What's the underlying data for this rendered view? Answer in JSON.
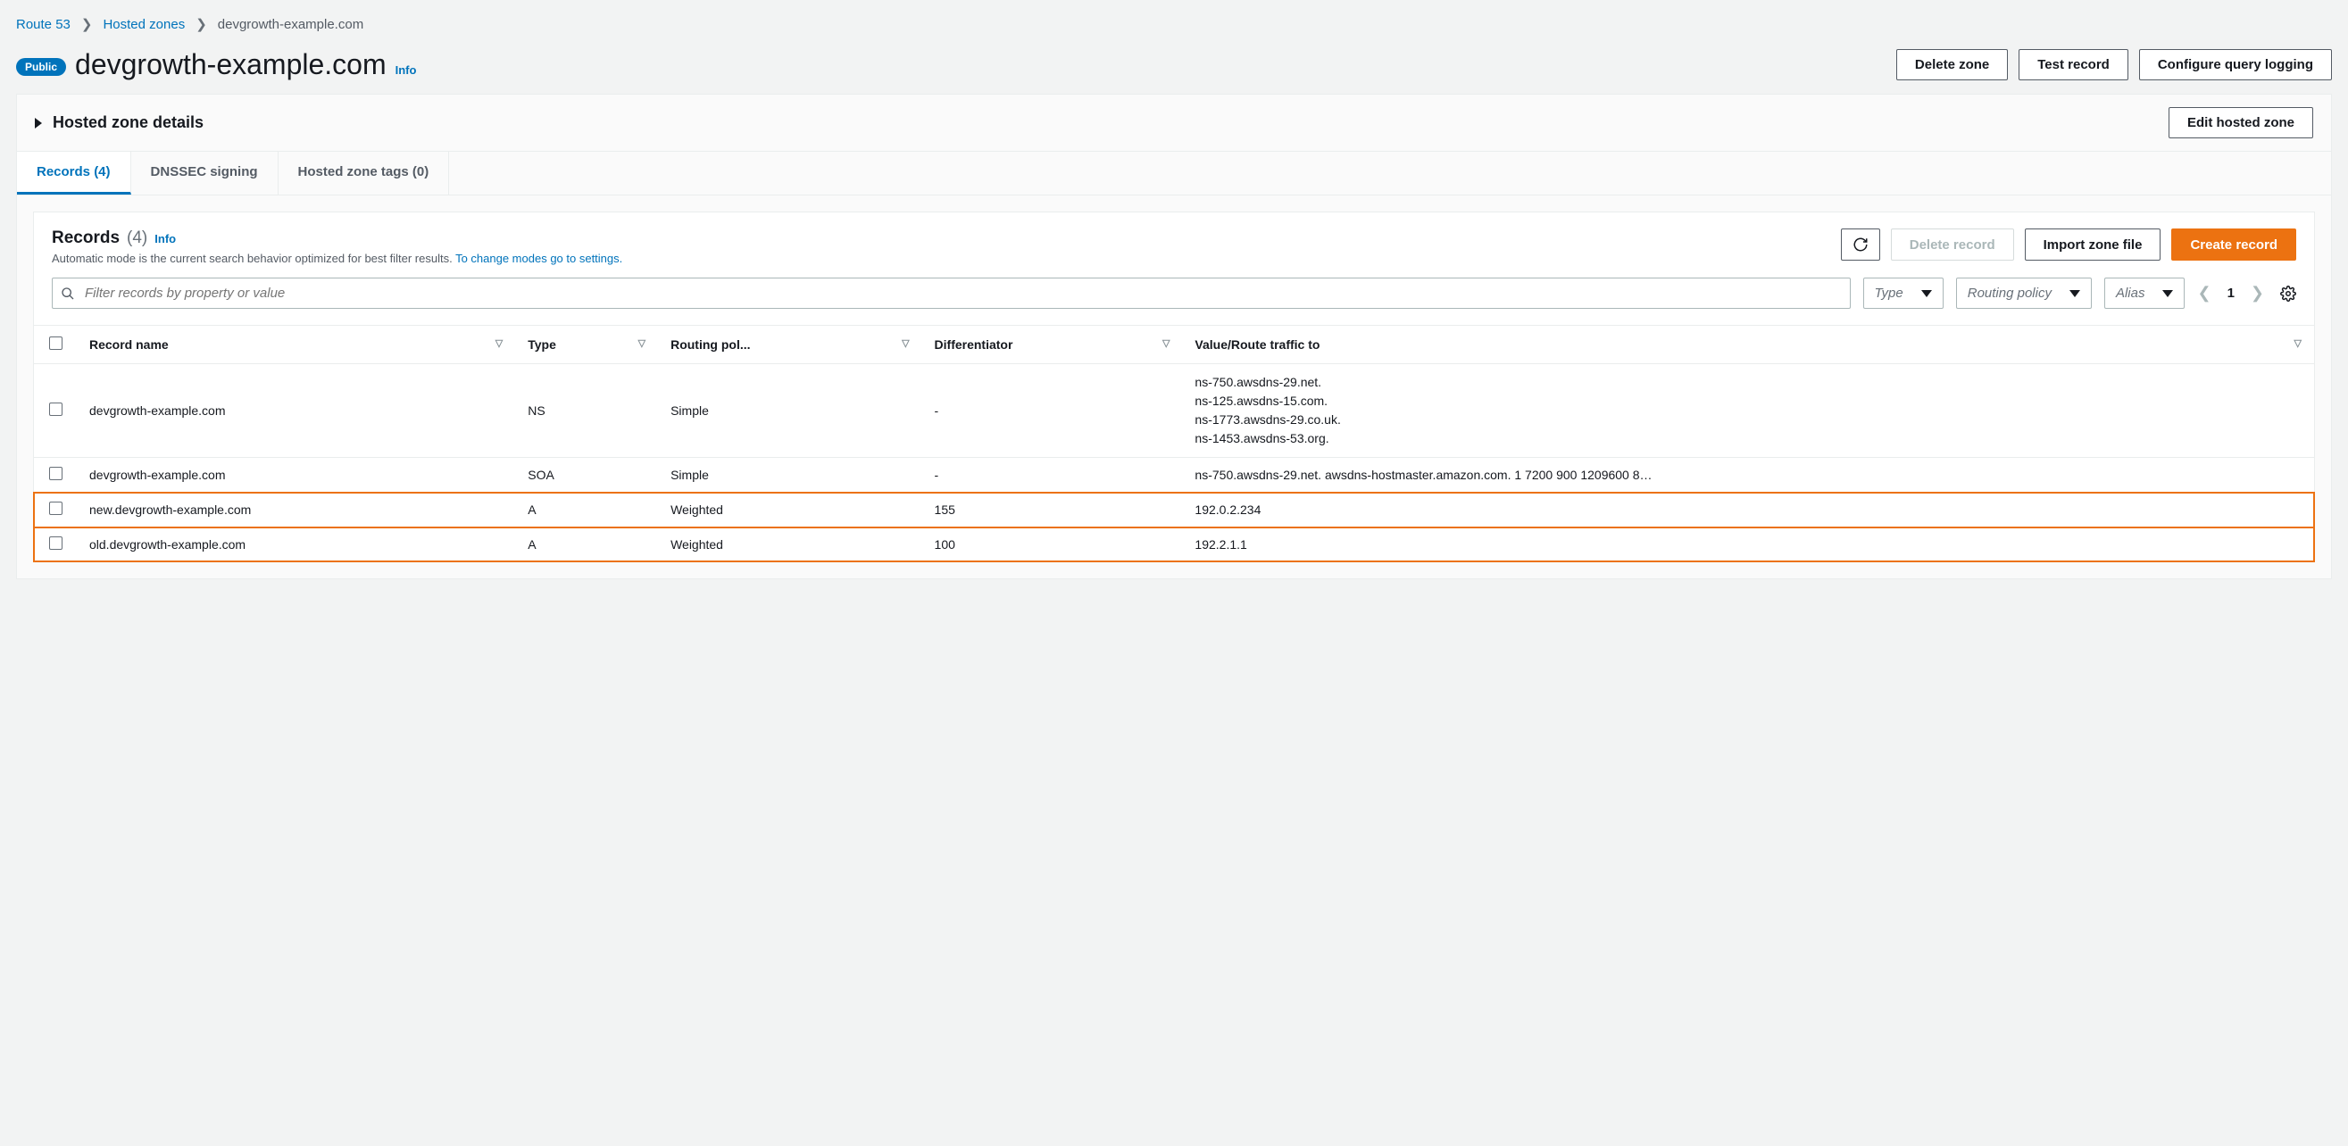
{
  "breadcrumb": {
    "root": "Route 53",
    "mid": "Hosted zones",
    "current": "devgrowth-example.com"
  },
  "header": {
    "badge": "Public",
    "title": "devgrowth-example.com",
    "info": "Info",
    "buttons": {
      "delete_zone": "Delete zone",
      "test_record": "Test record",
      "configure_logging": "Configure query logging"
    }
  },
  "hz_details": {
    "title": "Hosted zone details",
    "edit_btn": "Edit hosted zone"
  },
  "tabs": {
    "records": "Records (4)",
    "dnssec": "DNSSEC signing",
    "tags": "Hosted zone tags (0)"
  },
  "records_section": {
    "title": "Records",
    "count": "(4)",
    "info": "Info",
    "subtitle_pre": "Automatic mode is the current search behavior optimized for best filter results. ",
    "subtitle_link": "To change modes go to settings.",
    "buttons": {
      "delete": "Delete record",
      "import": "Import zone file",
      "create": "Create record"
    },
    "filters": {
      "search_placeholder": "Filter records by property or value",
      "type": "Type",
      "routing": "Routing policy",
      "alias": "Alias"
    },
    "pager": {
      "page": "1"
    }
  },
  "table": {
    "headers": {
      "name": "Record name",
      "type": "Type",
      "routing": "Routing pol...",
      "diff": "Differentiator",
      "value": "Value/Route traffic to"
    },
    "rows": [
      {
        "name": "devgrowth-example.com",
        "type": "NS",
        "routing": "Simple",
        "diff": "-",
        "value": "ns-750.awsdns-29.net.\nns-125.awsdns-15.com.\nns-1773.awsdns-29.co.uk.\nns-1453.awsdns-53.org."
      },
      {
        "name": "devgrowth-example.com",
        "type": "SOA",
        "routing": "Simple",
        "diff": "-",
        "value": "ns-750.awsdns-29.net. awsdns-hostmaster.amazon.com. 1 7200 900 1209600 8…"
      },
      {
        "name": "new.devgrowth-example.com",
        "type": "A",
        "routing": "Weighted",
        "diff": "155",
        "value": "192.0.2.234"
      },
      {
        "name": "old.devgrowth-example.com",
        "type": "A",
        "routing": "Weighted",
        "diff": "100",
        "value": "192.2.1.1"
      }
    ]
  }
}
